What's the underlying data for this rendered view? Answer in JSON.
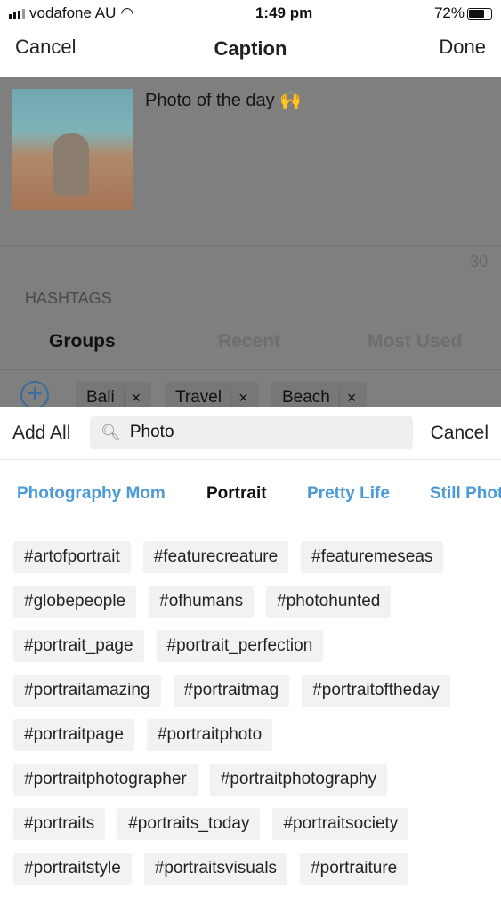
{
  "status": {
    "carrier": "vodafone AU",
    "time": "1:49 pm",
    "battery": "72%",
    "battery_level": 0.72
  },
  "nav": {
    "cancel": "Cancel",
    "title": "Caption",
    "done": "Done"
  },
  "caption": {
    "text": "Photo of the day 🙌",
    "char_count": "30"
  },
  "hashtags": {
    "label": "HASHTAGS",
    "tabs": [
      "Groups",
      "Recent",
      "Most Used"
    ],
    "chips": [
      "Bali",
      "Travel",
      "Beach"
    ],
    "remove": "×",
    "add": "+"
  },
  "search": {
    "add_all": "Add All",
    "value": "Photo",
    "cancel": "Cancel"
  },
  "groups": [
    {
      "label": "Photography Mom"
    },
    {
      "label": "Portrait"
    },
    {
      "label": "Pretty Life"
    },
    {
      "label": "Still Photo"
    }
  ],
  "tags": [
    [
      "#artofportrait",
      "#featurecreature",
      "#featuremeseas"
    ],
    [
      "#globepeople",
      "#ofhumans",
      "#photohunted"
    ],
    [
      "#portrait_page",
      "#portrait_perfection"
    ],
    [
      "#portraitamazing",
      "#portraitmag",
      "#portraitoftheday"
    ],
    [
      "#portraitpage",
      "#portraitphoto"
    ],
    [
      "#portraitphotographer",
      "#portraitphotography"
    ],
    [
      "#portraits",
      "#portraits_today",
      "#portraitsociety"
    ],
    [
      "#portraitstyle",
      "#portraitsvisuals",
      "#portraiture"
    ]
  ]
}
